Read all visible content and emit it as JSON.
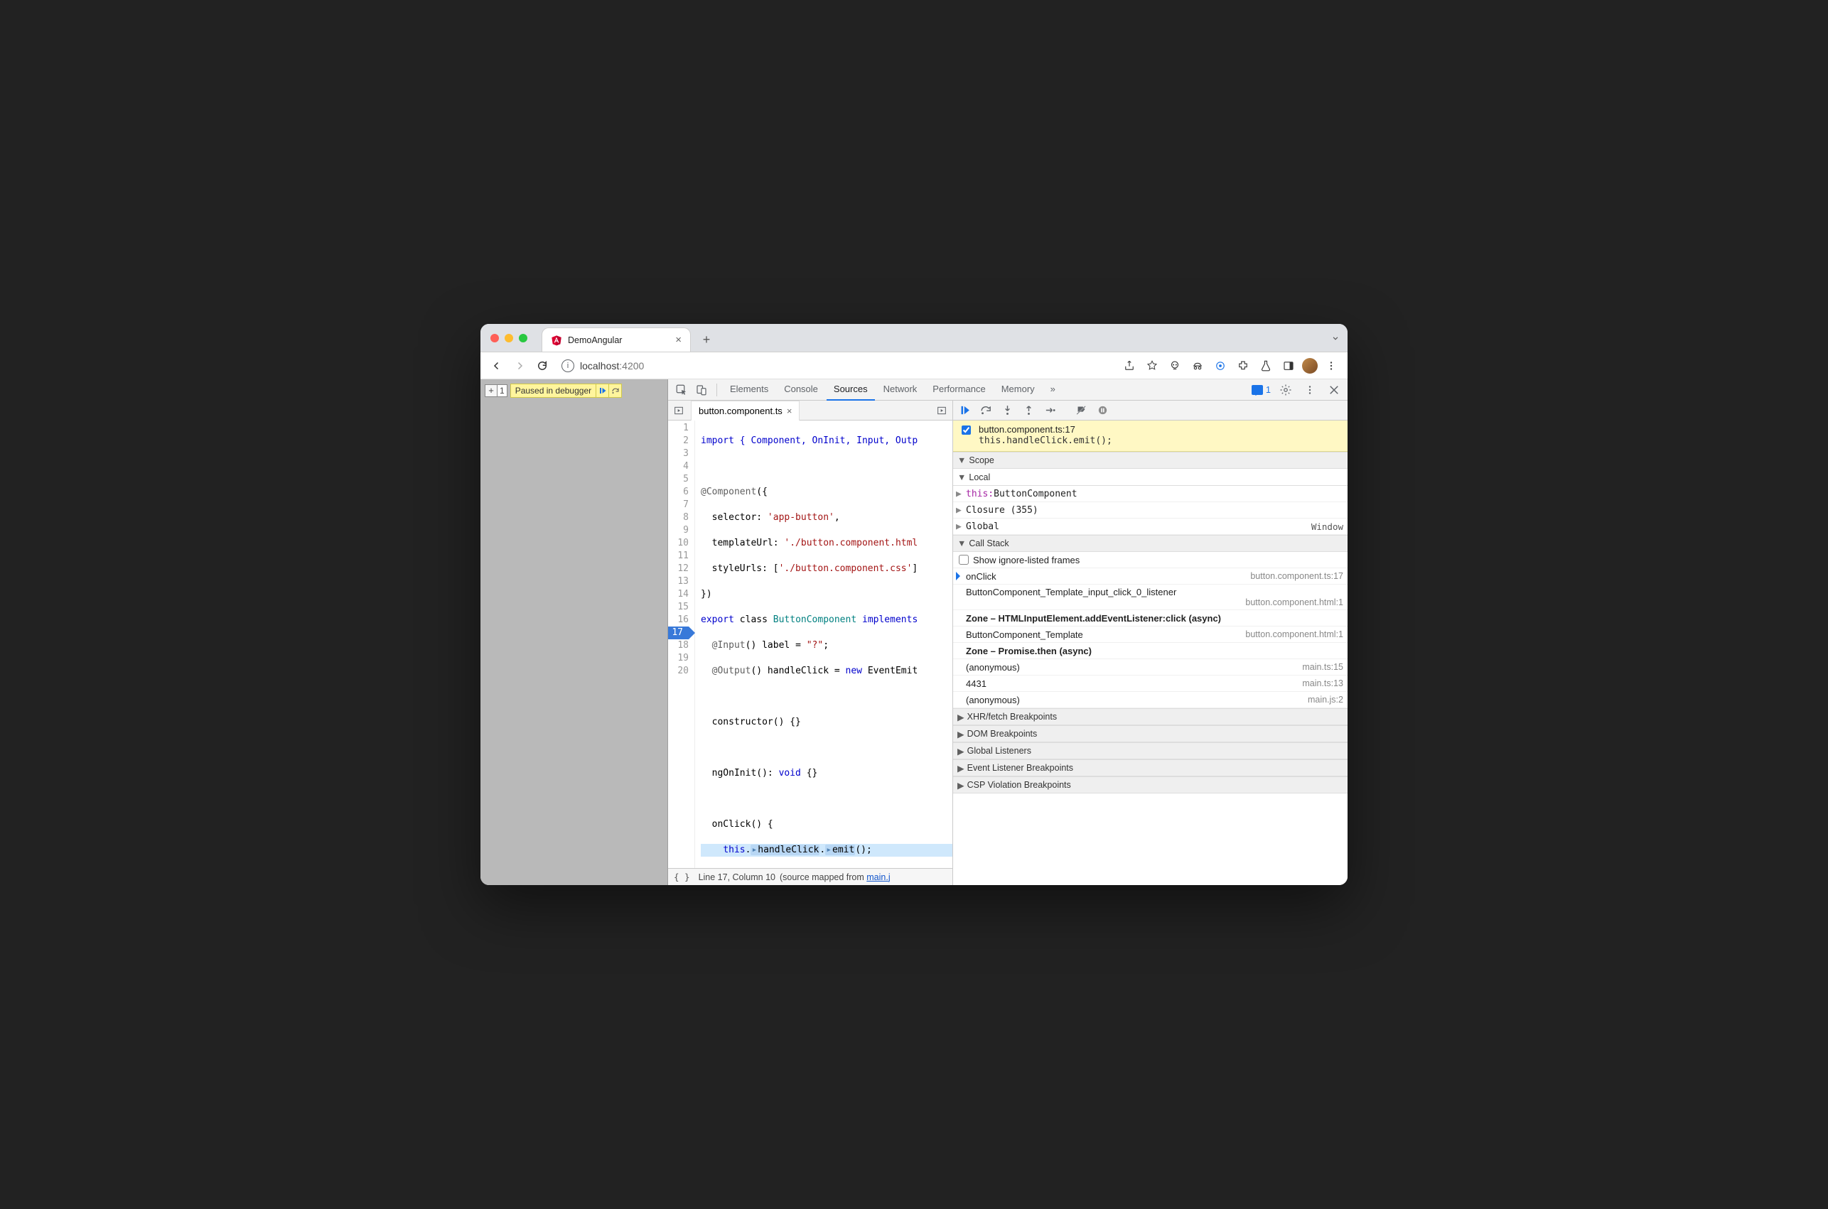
{
  "tab": {
    "title": "DemoAngular"
  },
  "url": {
    "host": "localhost",
    "port": ":4200"
  },
  "paused_pill": "Paused in debugger",
  "devtools_tabs": [
    "Elements",
    "Console",
    "Sources",
    "Network",
    "Performance",
    "Memory"
  ],
  "devtools_active_tab": "Sources",
  "more_tabs_glyph": "»",
  "issues_count": "1",
  "editor": {
    "file": "button.component.ts",
    "line_numbers": [
      "1",
      "2",
      "3",
      "4",
      "5",
      "6",
      "7",
      "8",
      "9",
      "10",
      "11",
      "12",
      "13",
      "14",
      "15",
      "16",
      "17",
      "18",
      "19",
      "20"
    ],
    "highlight_line": "17",
    "status_line": "Line 17, Column 10",
    "mapped_prefix": "(source mapped from ",
    "mapped_file": "main.j",
    "src": {
      "l1": "import { Component, OnInit, Input, Outp",
      "l3a": "@Component",
      "l3b": "({",
      "l4a": "  selector: ",
      "l4b": "'app-button'",
      "l4c": ",",
      "l5a": "  templateUrl: ",
      "l5b": "'./button.component.html",
      "l6a": "  styleUrls: [",
      "l6b": "'./button.component.css'",
      "l6c": "]",
      "l7": "})",
      "l8a": "export",
      "l8b": " class ",
      "l8c": "ButtonComponent",
      "l8d": " implements",
      "l9a": "  @Input",
      "l9b": "() label = ",
      "l9c": "\"?\"",
      "l9d": ";",
      "l10a": "  @Output",
      "l10b": "() handleClick = ",
      "l10c": "new",
      "l10d": " EventEmit",
      "l12": "  constructor() {}",
      "l14a": "  ngOnInit(): ",
      "l14b": "void",
      "l14c": " {}",
      "l16": "  onClick() {",
      "l17a": "    ",
      "l17b": "this",
      "l17c": ".",
      "l17d": "handleClick",
      "l17e": ".",
      "l17f": "emit",
      "l17g": "();",
      "l18": "  }",
      "l19": "}"
    }
  },
  "breakpoint": {
    "file": "button.component.ts:17",
    "code": "this.handleClick.emit();"
  },
  "scope": {
    "header": "Scope",
    "local": "Local",
    "this_lbl": "this:",
    "this_val": " ButtonComponent",
    "closure": "Closure (355)",
    "global_lbl": "Global",
    "global_val": "Window"
  },
  "callstack": {
    "header": "Call Stack",
    "show_ignored": "Show ignore-listed frames",
    "frames": [
      {
        "name": "onClick",
        "loc": "button.component.ts:17",
        "active": true
      },
      {
        "name": "ButtonComponent_Template_input_click_0_listener",
        "loc": "button.component.html:1"
      },
      {
        "name": "Zone – HTMLInputElement.addEventListener:click (async)",
        "async": true
      },
      {
        "name": "ButtonComponent_Template",
        "loc": "button.component.html:1"
      },
      {
        "name": "Zone – Promise.then (async)",
        "async": true
      },
      {
        "name": "(anonymous)",
        "loc": "main.ts:15"
      },
      {
        "name": "4431",
        "loc": "main.ts:13"
      },
      {
        "name": "(anonymous)",
        "loc": "main.js:2"
      }
    ]
  },
  "panels": {
    "xhr": "XHR/fetch Breakpoints",
    "dom": "DOM Breakpoints",
    "listeners": "Global Listeners",
    "event": "Event Listener Breakpoints",
    "csp": "CSP Violation Breakpoints"
  }
}
